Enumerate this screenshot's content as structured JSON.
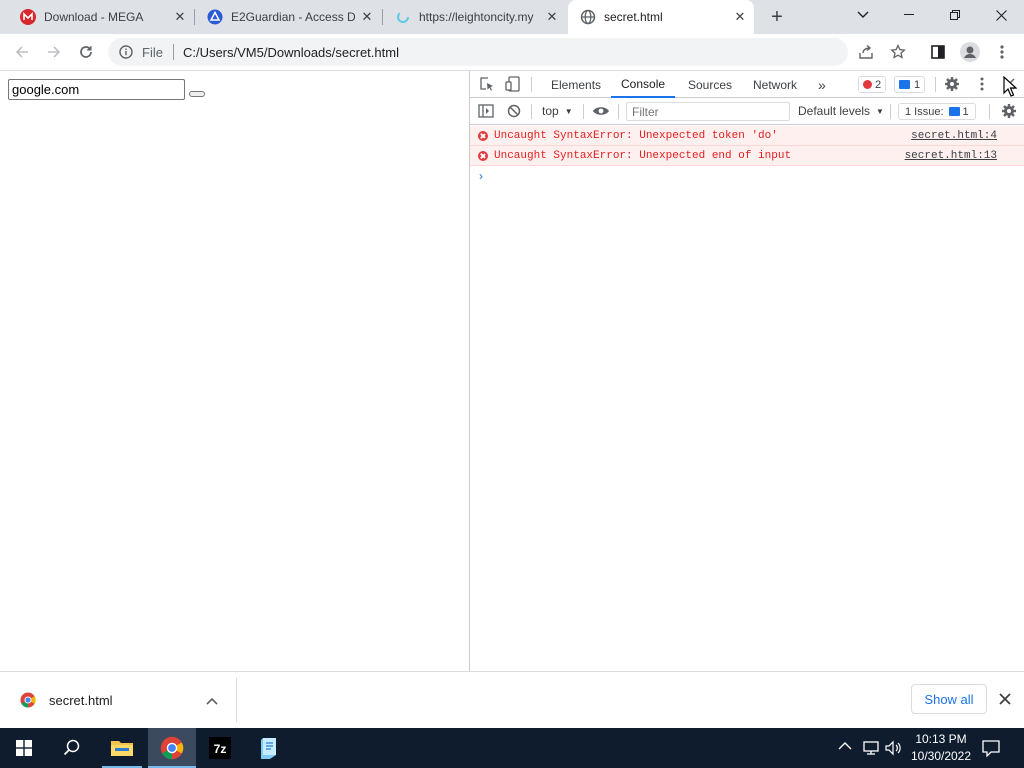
{
  "tabs": [
    {
      "title": "Download - MEGA",
      "favicon": "mega-icon"
    },
    {
      "title": "E2Guardian - Access De",
      "favicon": "e2guardian-icon"
    },
    {
      "title": "https://leightoncity.my",
      "favicon": "loading-icon"
    },
    {
      "title": "secret.html",
      "favicon": "globe-icon",
      "active": true
    }
  ],
  "toolbar": {
    "scheme_label": "File",
    "url": "C:/Users/VM5/Downloads/secret.html"
  },
  "page": {
    "input_value": "google.com"
  },
  "devtools": {
    "tabs": [
      "Elements",
      "Console",
      "Sources",
      "Network"
    ],
    "active_tab": "Console",
    "error_count": "2",
    "message_count": "1",
    "context": "top",
    "filter_placeholder": "Filter",
    "levels": "Default levels",
    "issues_label": "1 Issue:",
    "issues_count": "1",
    "messages": [
      {
        "text": "Uncaught SyntaxError: Unexpected token 'do'",
        "source": "secret.html:4"
      },
      {
        "text": "Uncaught SyntaxError: Unexpected end of input",
        "source": "secret.html:13"
      }
    ]
  },
  "downloads": {
    "file": "secret.html",
    "show_all": "Show all"
  },
  "taskbar": {
    "time": "10:13 PM",
    "date": "10/30/2022"
  },
  "colors": {
    "accent": "#1a73e8",
    "error": "#e41e1e",
    "taskbar": "#0f1c2e"
  }
}
